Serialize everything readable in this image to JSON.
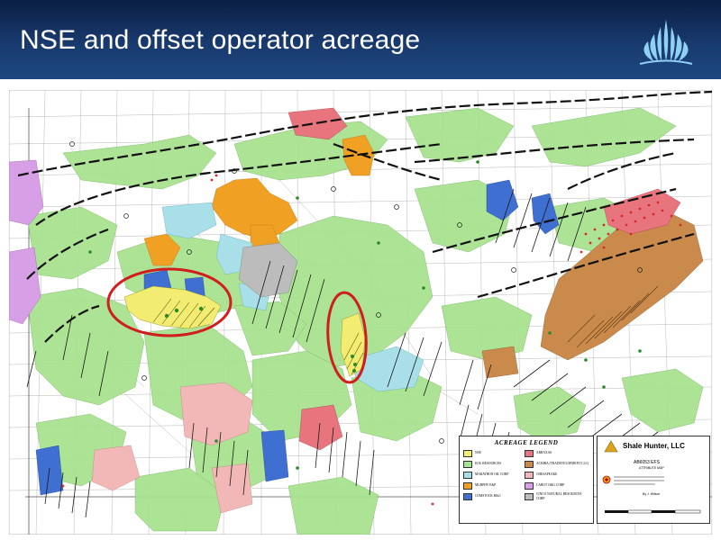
{
  "slide": {
    "title": "NSE and offset operator acreage"
  },
  "legend": {
    "title": "ACREAGE LEGEND",
    "items": [
      {
        "label": "NSE",
        "color": "#f3ec72"
      },
      {
        "label": "ABRAXAS",
        "color": "#e8757d"
      },
      {
        "label": "EOG RESOURCES",
        "color": "#a8e290"
      },
      {
        "label": "ACHIRA (TRADEVELOPMENT LLC)",
        "color": "#c98a4b"
      },
      {
        "label": "MARATHON OIL CORP",
        "color": "#a8dfe8"
      },
      {
        "label": "CHESAPEAKE",
        "color": "#f2b8b8"
      },
      {
        "label": "MURPHY E&P",
        "color": "#f0a022"
      },
      {
        "label": "CABOT O&G CORP",
        "color": "#d79fe6"
      },
      {
        "label": "COMSTOCK R&G",
        "color": "#3e6fd1"
      },
      {
        "label": "CINCO NATURAL RESOURCES CORP",
        "color": "#bcbcbc"
      }
    ]
  },
  "titleblock": {
    "company": "Shale Hunter, LLC",
    "map_ref": "AB6053 EFS",
    "subtitle": "ATTRIBUTE MAP",
    "author": "By J. Wilson"
  },
  "colors": {
    "header_dark": "#0c1f44",
    "header_light": "#1d4780",
    "highlight_ellipse": "#d01e1e",
    "fault_lines": "#111111"
  },
  "icons": [
    "company-logo-icon",
    "well-symbol-icon",
    "fault-line-icon"
  ]
}
